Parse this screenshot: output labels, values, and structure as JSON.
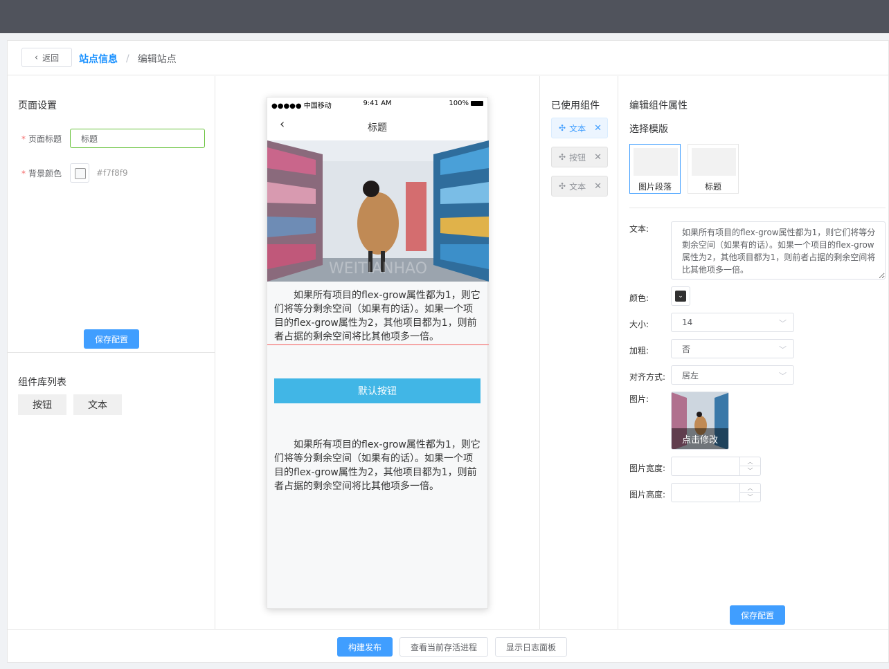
{
  "header": {
    "back_label": "返回",
    "breadcrumb_parent": "站点信息",
    "breadcrumb_separator": "/",
    "breadcrumb_current": "编辑站点"
  },
  "page_settings": {
    "title": "页面设置",
    "page_title_label": "页面标题",
    "page_title_value": "标题",
    "bg_color_label": "背景颜色",
    "bg_color_value": "#f7f8f9",
    "save_label": "保存配置"
  },
  "library": {
    "title": "组件库列表",
    "items": [
      "按钮",
      "文本"
    ]
  },
  "phone": {
    "carrier": "●●●●● 中国移动",
    "time": "9:41 AM",
    "battery": "100%",
    "nav_title": "标题",
    "photo_watermark": "WEITIANHAO",
    "paragraph1": "如果所有项目的flex-grow属性都为1，则它们将等分剩余空间（如果有的话）。如果一个项目的flex-grow属性为2，其他项目都为1，则前者占据的剩余空间将比其他项多一倍。",
    "button_label": "默认按钮",
    "paragraph2": "如果所有项目的flex-grow属性都为1，则它们将等分剩余空间（如果有的话）。如果一个项目的flex-grow属性为2，其他项目都为1，则前者占据的剩余空间将比其他项多一倍。"
  },
  "used": {
    "title": "已使用组件",
    "items": [
      "文本",
      "按钮",
      "文本"
    ]
  },
  "props": {
    "title": "编辑组件属性",
    "template_title": "选择模版",
    "templates": [
      "图片段落",
      "标题"
    ],
    "text_label": "文本:",
    "text_value": "如果所有项目的flex-grow属性都为1，则它们将等分剩余空间（如果有的话）。如果一个项目的flex-grow属性为2，其他项目都为1，则前者占据的剩余空间将比其他项多一倍。",
    "color_label": "颜色:",
    "color_value": "#303030",
    "size_label": "大小:",
    "size_value": "14",
    "bold_label": "加粗:",
    "bold_value": "否",
    "align_label": "对齐方式:",
    "align_value": "居左",
    "image_label": "图片:",
    "image_overlay": "点击修改",
    "image_width_label": "图片宽度:",
    "image_width_value": "",
    "image_height_label": "图片高度:",
    "image_height_value": "",
    "save_label": "保存配置"
  },
  "footer": {
    "publish_label": "构建发布",
    "process_label": "查看当前存活进程",
    "log_label": "显示日志面板"
  },
  "colors": {
    "primary": "#409eff",
    "phone_button": "#41b6e6",
    "topbar": "#50535c",
    "valid_border": "#67c23a"
  }
}
